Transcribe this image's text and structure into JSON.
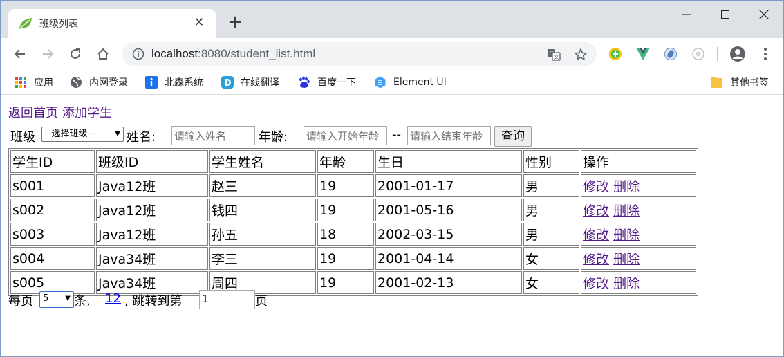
{
  "browser": {
    "tab_title": "班级列表",
    "url_host": "localhost",
    "url_rest": ":8080/student_list.html",
    "bookmarks": [
      {
        "label": "应用",
        "icon": "apps-grid-icon"
      },
      {
        "label": "内网登录",
        "icon": "globe-icon"
      },
      {
        "label": "北森系统",
        "icon": "info-icon"
      },
      {
        "label": "在线翻译",
        "icon": "translate-d-icon"
      },
      {
        "label": "百度一下",
        "icon": "baidu-paw-icon"
      },
      {
        "label": "Element UI",
        "icon": "element-ui-icon"
      }
    ],
    "other_bookmarks": "其他书签"
  },
  "page": {
    "links": {
      "home": "返回首页",
      "add": "添加学生"
    },
    "filter": {
      "class_label": "班级",
      "class_select": "--选择班级--",
      "name_label": "姓名:",
      "name_placeholder": "请输入姓名",
      "age_label": "年龄:",
      "age_start_placeholder": "请输入开始年龄",
      "range_sep": "--",
      "age_end_placeholder": "请输入结束年龄",
      "query_button": "查询"
    },
    "table": {
      "headers": [
        "学生ID",
        "班级ID",
        "学生姓名",
        "年龄",
        "生日",
        "性别",
        "操作"
      ],
      "rows": [
        {
          "id": "s001",
          "class": "Java12班",
          "name": "赵三",
          "age": "19",
          "birthday": "2001-01-17",
          "gender": "男"
        },
        {
          "id": "s002",
          "class": "Java12班",
          "name": "钱四",
          "age": "19",
          "birthday": "2001-05-16",
          "gender": "男"
        },
        {
          "id": "s003",
          "class": "Java12班",
          "name": "孙五",
          "age": "18",
          "birthday": "2002-03-15",
          "gender": "男"
        },
        {
          "id": "s004",
          "class": "Java34班",
          "name": "李三",
          "age": "19",
          "birthday": "2001-04-14",
          "gender": "女"
        },
        {
          "id": "s005",
          "class": "Java34班",
          "name": "周四",
          "age": "19",
          "birthday": "2001-02-13",
          "gender": "女"
        }
      ],
      "edit_label": "修改",
      "delete_label": "删除"
    },
    "pager": {
      "per_page_label": "每页",
      "per_page_value": "5",
      "unit_label": "条,",
      "page_link_1": "1",
      "page_link_2": "2",
      "sep_label": ", 跳转到第",
      "jump_value": "1",
      "page_suffix": "页"
    }
  }
}
